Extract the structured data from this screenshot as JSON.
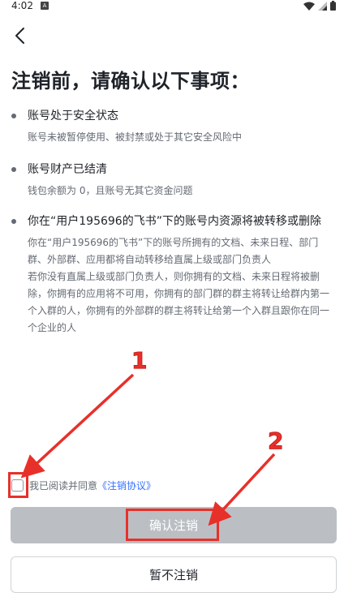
{
  "status_bar": {
    "time": "4:02",
    "notification_icon": "A",
    "icons": [
      "wifi-icon",
      "signal-icon",
      "battery-icon"
    ]
  },
  "page": {
    "title": "注销前，请确认以下事项："
  },
  "items": [
    {
      "title": "账号处于安全状态",
      "desc": [
        "账号未被暂停使用、被封禁或处于其它安全风险中"
      ]
    },
    {
      "title": "账号财产已结清",
      "desc": [
        "钱包余额为 0，且账号无其它资金问题"
      ]
    },
    {
      "title": "你在“用户195696的飞书”下的账号内资源将被转移或删除",
      "desc": [
        "你在“用户195696的飞书”下的账号所拥有的文档、未来日程、部门群、外部群、应用都将自动转移给直属上级或部门负责人",
        "若你没有直属上级或部门负责人，则你拥有的文档、未来日程将被删除，你拥有的应用将不可用，你拥有的部门群的群主将转让给群内第一个入群的人，你拥有的外部群的群主将转让给第一个入群且跟你在同一个企业的人"
      ]
    }
  ],
  "agreement": {
    "text": "我已阅读并同意",
    "link": "《注销协议》",
    "checked": false
  },
  "buttons": {
    "confirm": "确认注销",
    "cancel": "暂不注销"
  },
  "annotations": {
    "label_1": "1",
    "label_2": "2",
    "color": "#e8302a"
  },
  "colors": {
    "primary_text": "#1f2329",
    "secondary_text": "#646a73",
    "link": "#3370ff",
    "disabled_button": "#bbbfc4"
  }
}
